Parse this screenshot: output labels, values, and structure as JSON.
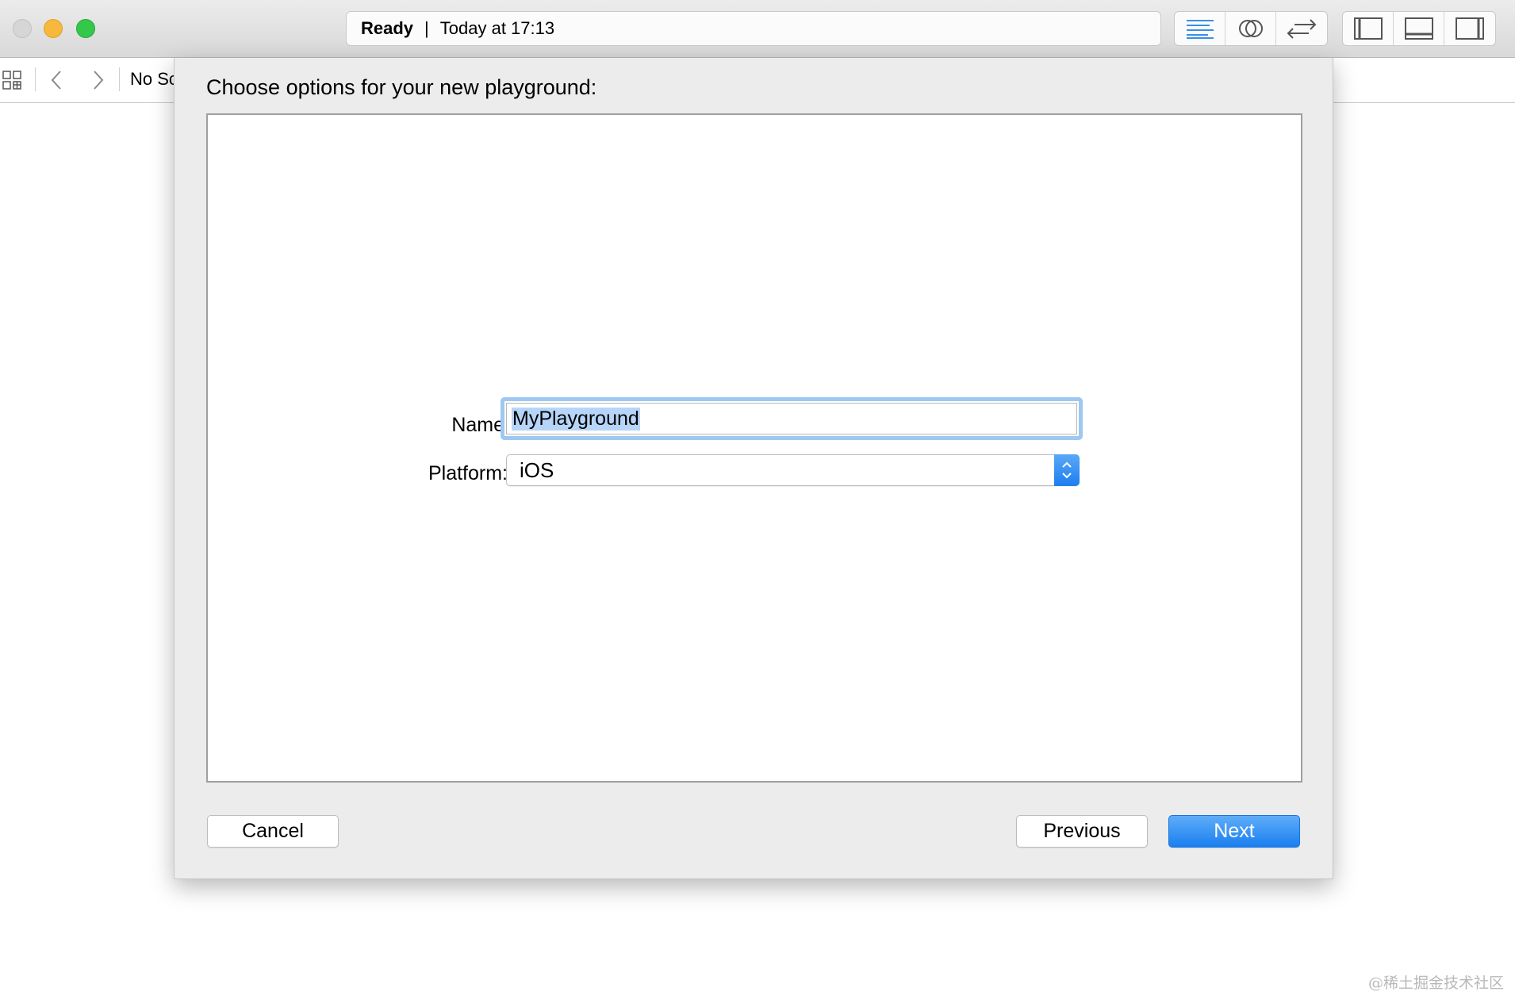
{
  "window": {
    "traffic_lights": [
      "close",
      "minimize",
      "zoom"
    ],
    "colors": {
      "close": "#d6d6d6",
      "minimize": "#f6b93b",
      "zoom": "#34c84a"
    }
  },
  "activity": {
    "status": "Ready",
    "separator": "|",
    "timestamp": "Today at 17:13"
  },
  "toolbar": {
    "editor_modes": [
      "standard-editor-icon",
      "assistant-editor-icon",
      "version-editor-icon"
    ],
    "view_toggles": [
      "navigator-panel-icon",
      "debug-area-icon",
      "utilities-panel-icon"
    ]
  },
  "jumpbar": {
    "text": "No Sc"
  },
  "sheet": {
    "title": "Choose options for your new playground:",
    "name_label": "Name",
    "name_value": "MyPlayground",
    "platform_label": "Platform:",
    "platform_value": "iOS",
    "cancel_label": "Cancel",
    "previous_label": "Previous",
    "next_label": "Next",
    "accent_color": "#1a7ff0"
  },
  "watermark": "@稀土掘金技术社区"
}
